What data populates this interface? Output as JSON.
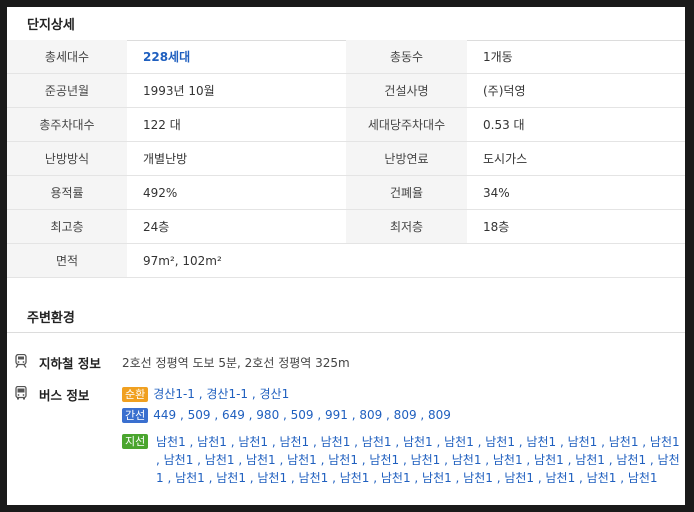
{
  "detail": {
    "title": "단지상세",
    "rows": [
      {
        "l1": "총세대수",
        "v1": "228세대",
        "l2": "총동수",
        "v2": "1개동"
      },
      {
        "l1": "준공년월",
        "v1": "1993년 10월",
        "l2": "건설사명",
        "v2": "(주)덕영"
      },
      {
        "l1": "총주차대수",
        "v1": "122 대",
        "l2": "세대당주차대수",
        "v2": "0.53 대"
      },
      {
        "l1": "난방방식",
        "v1": "개별난방",
        "l2": "난방연료",
        "v2": "도시가스"
      },
      {
        "l1": "용적률",
        "v1": "492%",
        "l2": "건폐율",
        "v2": "34%"
      },
      {
        "l1": "최고층",
        "v1": "24층",
        "l2": "최저층",
        "v2": "18층"
      },
      {
        "l1": "면적",
        "v1": "97m², 102m²"
      }
    ]
  },
  "env": {
    "title": "주변환경",
    "subway": {
      "label": "지하철 정보",
      "text": "2호선 정평역 도보 5분, 2호선 정평역 325m"
    },
    "bus": {
      "label": "버스 정보",
      "lines": [
        {
          "badge": "순환",
          "color": "#f0a020",
          "routes": "경산1-1 , 경산1-1 , 경산1"
        },
        {
          "badge": "간선",
          "color": "#3a6fcf",
          "routes": "449 , 509 , 649 , 980 , 509 , 991 , 809 , 809 , 809"
        },
        {
          "badge": "지선",
          "color": "#4aa52e",
          "routes": "남천1 , 남천1 , 남천1 , 남천1 , 남천1 , 남천1 , 남천1 , 남천1 , 남천1 , 남천1 , 남천1 , 남천1 , 남천1 , 남천1 , 남천1 , 남천1 , 남천1 , 남천1 , 남천1 , 남천1 , 남천1 , 남천1 , 남천1 , 남천1 , 남천1 , 남천1 , 남천1 , 남천1 , 남천1 , 남천1 , 남천1 , 남천1 , 남천1 , 남천1 , 남천1 , 남천1 , 남천1 , 남천1"
        }
      ]
    }
  },
  "icons": {
    "subway": "train-icon",
    "bus": "bus-icon"
  },
  "colors": {
    "link": "#1f5fbf",
    "label_bg": "#f5f5f5"
  }
}
